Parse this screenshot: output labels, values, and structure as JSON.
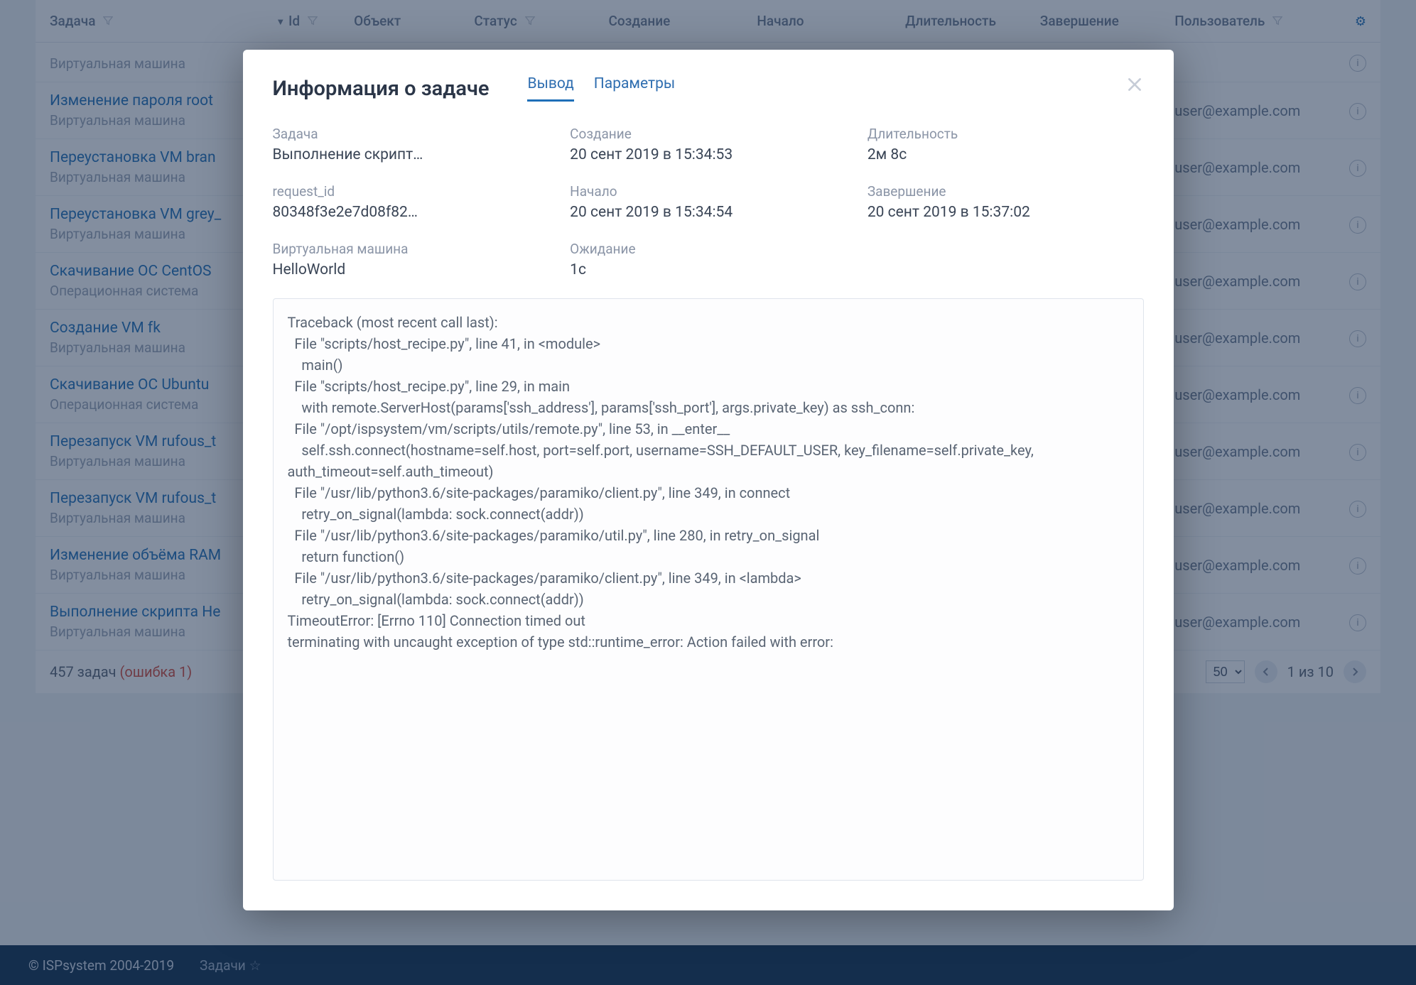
{
  "table": {
    "columns": {
      "task": "Задача",
      "id": "Id",
      "object": "Объект",
      "status": "Статус",
      "created": "Создание",
      "started": "Начало",
      "duration": "Длительность",
      "finished": "Завершение",
      "user": "Пользователь",
      "actions": ""
    },
    "subtypes": {
      "vm": "Виртуальная машина",
      "os": "Операционная система"
    },
    "rows": [
      {
        "title": "",
        "sub": "vm",
        "user": ""
      },
      {
        "title": "Изменение пароля root",
        "sub": "vm",
        "user": "user@example.com"
      },
      {
        "title": "Переустановка VM bran",
        "sub": "vm",
        "user": "user@example.com"
      },
      {
        "title": "Переустановка VM grey_",
        "sub": "vm",
        "user": "user@example.com"
      },
      {
        "title": "Скачивание ОС CentOS ",
        "sub": "os",
        "user": "user@example.com"
      },
      {
        "title": "Создание VM fk",
        "sub": "vm",
        "user": "user@example.com"
      },
      {
        "title": "Скачивание ОС Ubuntu ",
        "sub": "os",
        "user": "user@example.com"
      },
      {
        "title": "Перезапуск VM rufous_t",
        "sub": "vm",
        "user": "user@example.com"
      },
      {
        "title": "Перезапуск VM rufous_t",
        "sub": "vm",
        "user": "user@example.com"
      },
      {
        "title": "Изменение объёма RAM",
        "sub": "vm",
        "user": "user@example.com"
      },
      {
        "title": "Выполнение скрипта He",
        "sub": "vm",
        "user": "user@example.com"
      }
    ],
    "footer": {
      "count_text": "457 задач ",
      "error_text": "(ошибка 1)",
      "page_size": "50",
      "page_text": "1 из 10"
    }
  },
  "bottombar": {
    "copyright": "© ISPsystem 2004-2019",
    "breadcrumb": "Задачи"
  },
  "modal": {
    "title": "Информация о задаче",
    "tabs": {
      "output": "Вывод",
      "params": "Параметры"
    },
    "fields": {
      "task": {
        "label": "Задача",
        "value": "Выполнение скрипт…"
      },
      "created": {
        "label": "Создание",
        "value": "20 сент 2019 в 15:34:53"
      },
      "duration": {
        "label": "Длительность",
        "value": "2м 8с"
      },
      "request_id": {
        "label": "request_id",
        "value": "80348f3e2e7d08f82…"
      },
      "started": {
        "label": "Начало",
        "value": "20 сент 2019 в 15:34:54"
      },
      "finished": {
        "label": "Завершение",
        "value": "20 сент 2019 в 15:37:02"
      },
      "vm": {
        "label": "Виртуальная машина",
        "value": "HelloWorld"
      },
      "wait": {
        "label": "Ожидание",
        "value": "1с"
      }
    },
    "output": "Traceback (most recent call last):\n  File \"scripts/host_recipe.py\", line 41, in <module>\n    main()\n  File \"scripts/host_recipe.py\", line 29, in main\n    with remote.ServerHost(params['ssh_address'], params['ssh_port'], args.private_key) as ssh_conn:\n  File \"/opt/ispsystem/vm/scripts/utils/remote.py\", line 53, in __enter__\n    self.ssh.connect(hostname=self.host, port=self.port, username=SSH_DEFAULT_USER, key_filename=self.private_key, auth_timeout=self.auth_timeout)\n  File \"/usr/lib/python3.6/site-packages/paramiko/client.py\", line 349, in connect\n    retry_on_signal(lambda: sock.connect(addr))\n  File \"/usr/lib/python3.6/site-packages/paramiko/util.py\", line 280, in retry_on_signal\n    return function()\n  File \"/usr/lib/python3.6/site-packages/paramiko/client.py\", line 349, in <lambda>\n    retry_on_signal(lambda: sock.connect(addr))\nTimeoutError: [Errno 110] Connection timed out\nterminating with uncaught exception of type std::runtime_error: Action failed with error:"
  }
}
